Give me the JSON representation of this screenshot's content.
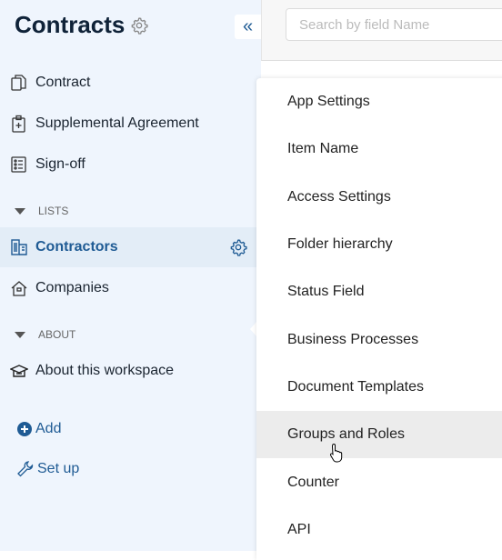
{
  "sidebar": {
    "title": "Contracts",
    "items": [
      {
        "label": "Contract",
        "icon": "copy-icon"
      },
      {
        "label": "Supplemental Agreement",
        "icon": "clipboard-plus-icon"
      },
      {
        "label": "Sign-off",
        "icon": "checklist-icon"
      }
    ],
    "sections": [
      {
        "label": "LISTS",
        "items": [
          {
            "label": "Contractors",
            "icon": "building-icon",
            "active": true
          },
          {
            "label": "Companies",
            "icon": "house-icon"
          }
        ]
      },
      {
        "label": "ABOUT",
        "items": [
          {
            "label": "About this workspace",
            "icon": "graduation-cap-icon"
          }
        ]
      }
    ],
    "add_label": "Add",
    "setup_label": "Set up"
  },
  "search": {
    "placeholder": "Search by field Name"
  },
  "menu": {
    "items": [
      "App Settings",
      "Item Name",
      "Access Settings",
      "Folder hierarchy",
      "Status Field",
      "Business Processes",
      "Document Templates",
      "Groups and Roles",
      "Counter",
      "API"
    ],
    "hovered": "Groups and Roles"
  },
  "colors": {
    "accent": "#1f5b94",
    "sidebar_bg": "#eff5fd",
    "active_bg": "#e3edf7"
  }
}
